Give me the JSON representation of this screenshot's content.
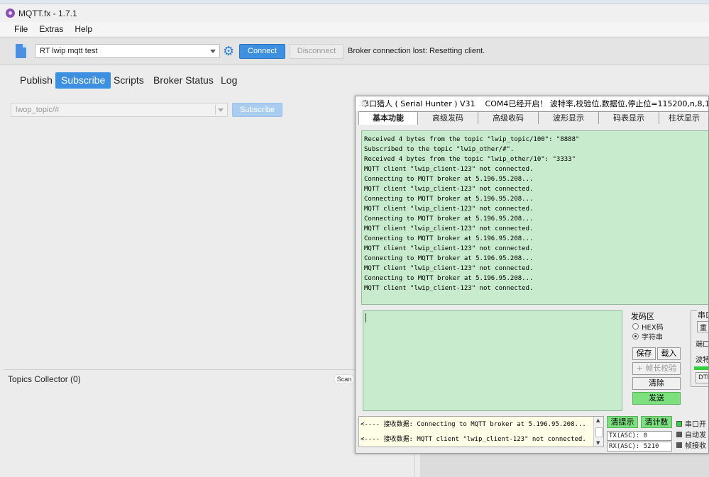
{
  "window": {
    "title": "MQTT.fx - 1.7.1"
  },
  "menu": [
    "File",
    "Extras",
    "Help"
  ],
  "toolbar": {
    "profile": "RT lwip mqtt test",
    "connect_label": "Connect",
    "disconnect_label": "Disconnect",
    "status": "Broker connection lost: Resetting client."
  },
  "tabs": [
    {
      "label": "Publish",
      "active": false
    },
    {
      "label": "Subscribe",
      "active": true
    },
    {
      "label": "Scripts",
      "active": false
    },
    {
      "label": "Broker Status",
      "active": false
    },
    {
      "label": "Log",
      "active": false
    }
  ],
  "subscribe": {
    "topic": "lwop_topic/#",
    "button_label": "Subscribe"
  },
  "topics_collector": {
    "label": "Topics Collector (0)",
    "scan_label": "Scan"
  },
  "serial_hunter": {
    "title": "串口猎人 ( Serial Hunter ) V31",
    "status_title": "COM4已经开启！ 波特率,校验位,数据位,停止位=115200,n,8,1",
    "tabs": [
      "基本功能",
      "高级发码",
      "高级收码",
      "波形显示",
      "码表显示",
      "柱状显示"
    ],
    "log": [
      "Received 4 bytes from the topic \"lwip_topic/100\": \"8888\"",
      "Subscribed to the topic \"lwip_other/#\".",
      "Received 4 bytes from the topic \"lwip_other/10\": \"3333\"",
      "MQTT client \"lwip_client-123\" not connected.",
      "Connecting to MQTT broker at 5.196.95.208...",
      "MQTT client \"lwip_client-123\" not connected.",
      "Connecting to MQTT broker at 5.196.95.208...",
      "MQTT client \"lwip_client-123\" not connected.",
      "Connecting to MQTT broker at 5.196.95.208...",
      "MQTT client \"lwip_client-123\" not connected.",
      "Connecting to MQTT broker at 5.196.95.208...",
      "MQTT client \"lwip_client-123\" not connected.",
      "Connecting to MQTT broker at 5.196.95.208...",
      "MQTT client \"lwip_client-123\" not connected.",
      "Connecting to MQTT broker at 5.196.95.208...",
      "MQTT client \"lwip_client-123\" not connected."
    ],
    "send_mode": {
      "title": "发码区",
      "hex_label": "HEX码",
      "string_label": "字符串",
      "selected": "string"
    },
    "buttons": {
      "save": "保存",
      "load": "载入",
      "frame_check": "+ 帧长校验",
      "clear": "清除",
      "send": "发送",
      "clear_hint": "清提示",
      "clear_count": "清计数"
    },
    "serial_group": {
      "title": "串口",
      "port_label": "端口",
      "baud_label": "波特",
      "btn_label": "重",
      "dtr_label": "DTR"
    },
    "status_lines": [
      "<---- 接收数据: Connecting to MQTT broker at 5.196.95.208...",
      "<---- 接收数据: MQTT client \"lwip_client-123\" not connected."
    ],
    "tx_counter": "TX(ASC): 0",
    "rx_counter": "RX(ASC): 5210",
    "leds": [
      {
        "label": "串口开",
        "color": "#2fd23a"
      },
      {
        "label": "自动发",
        "color": "#555555"
      },
      {
        "label": "帧接收",
        "color": "#555555"
      }
    ]
  },
  "colors": {
    "accent": "#3d8fe0",
    "terminal_bg": "#c7ebcc",
    "send_green": "#7de07f"
  }
}
